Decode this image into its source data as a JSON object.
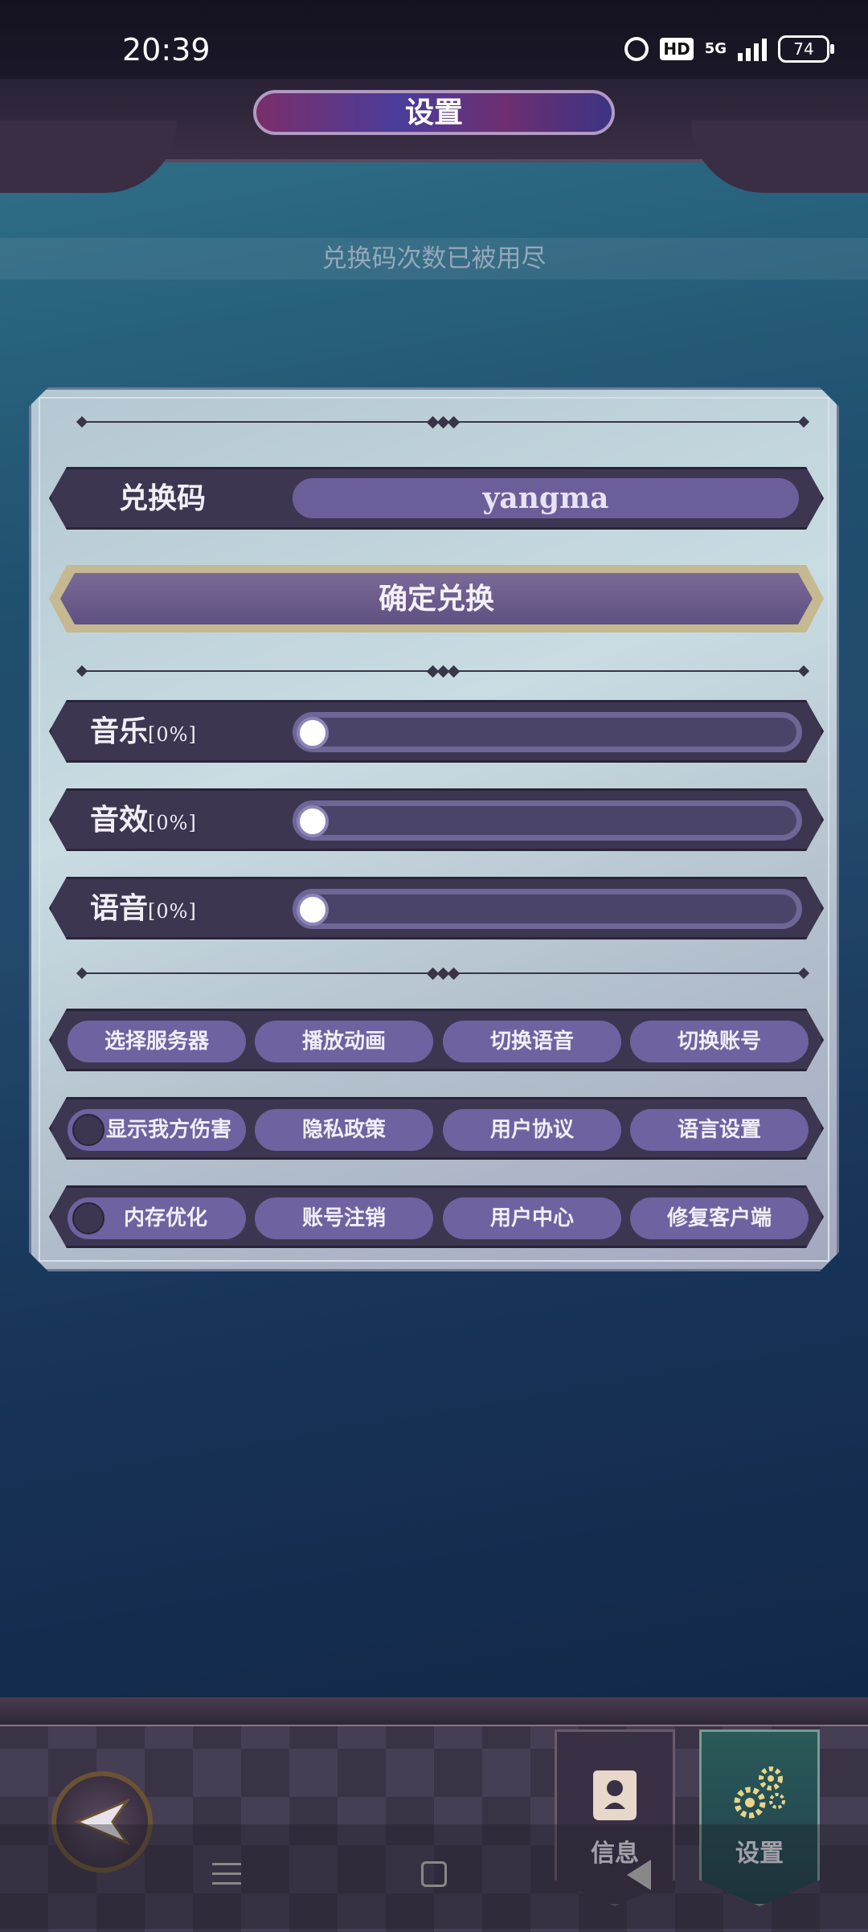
{
  "status_bar": {
    "time": "20:39",
    "hd": "HD",
    "network": "5G",
    "battery": "74"
  },
  "header": {
    "title": "设置"
  },
  "notice": "兑换码次数已被用尽",
  "redeem": {
    "label": "兑换码",
    "value": "yangma",
    "confirm_label": "确定兑换"
  },
  "audio": [
    {
      "label": "音乐",
      "percent_text": "[0%]",
      "level": 0
    },
    {
      "label": "音效",
      "percent_text": "[0%]",
      "level": 0
    },
    {
      "label": "语音",
      "percent_text": "[0%]",
      "level": 0
    }
  ],
  "buttons": {
    "row1": [
      "选择服务器",
      "播放动画",
      "切换语音",
      "切换账号"
    ],
    "row2": [
      "显示我方伤害",
      "隐私政策",
      "用户协议",
      "语言设置"
    ],
    "row3": [
      "内存优化",
      "账号注销",
      "用户中心",
      "修复客户端"
    ]
  },
  "toggles": {
    "show_damage": false,
    "memory_optimize": false
  },
  "tabs": {
    "info": "信息",
    "settings": "设置"
  },
  "colors": {
    "accent": "#6e63a0",
    "panel": "#c8dce2",
    "row_bg": "#3c3650"
  }
}
